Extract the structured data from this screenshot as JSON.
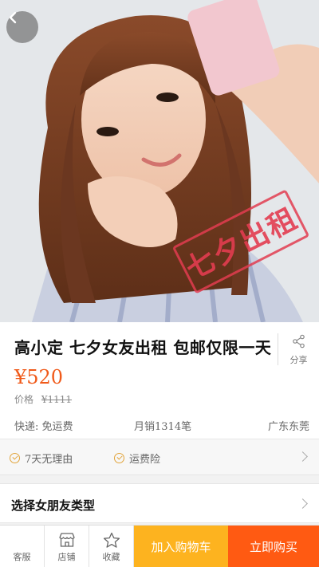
{
  "hero": {
    "stamp_text": "七夕出租"
  },
  "product": {
    "title": "高小定 七夕女友出租 包邮仅限一天",
    "share_label": "分享",
    "price": "¥520",
    "old_price_label": "价格",
    "old_price": "¥1111",
    "shipping": "快递: 免运费",
    "monthly_sales": "月销1314笔",
    "location": "广东东莞"
  },
  "guarantees": {
    "item1": "7天无理由",
    "item2": "运费险"
  },
  "select": {
    "label": "选择女朋友类型"
  },
  "bottom_bar": {
    "service": "客服",
    "shop": "店铺",
    "favorite": "收藏",
    "add_to_cart": "加入购物车",
    "buy_now": "立即购买"
  },
  "colors": {
    "price": "#f05a1a",
    "cart": "#fdb31f",
    "buy": "#ff5a12",
    "stamp": "#e23c50"
  }
}
